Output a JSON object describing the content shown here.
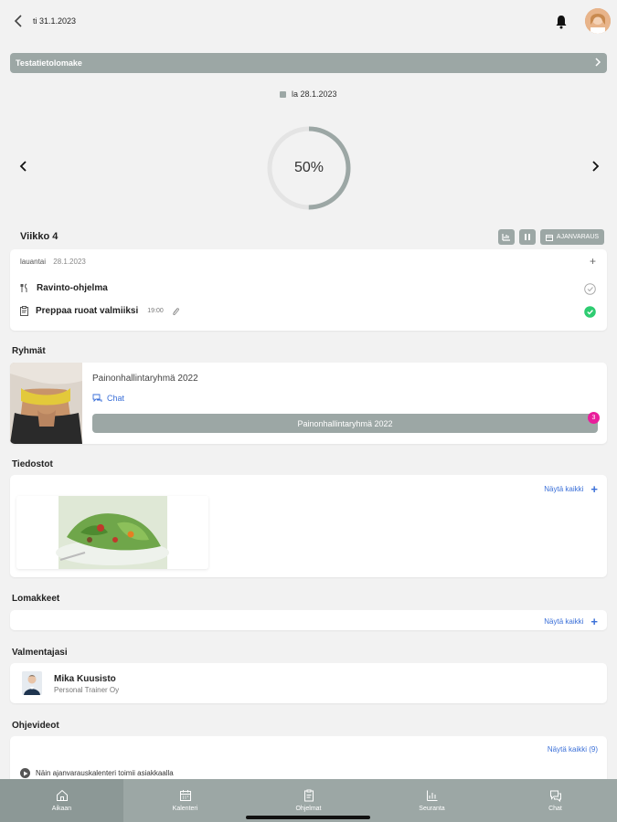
{
  "header": {
    "date": "ti 31.1.2023"
  },
  "form_bar": {
    "label": "Testatietolomake"
  },
  "day_legend": {
    "label": "la 28.1.2023"
  },
  "progress": {
    "value_text": "50%",
    "fraction": 0.5
  },
  "week": {
    "title": "Viikko 4",
    "button_calendar_label": "AJANVARAUS"
  },
  "day_card": {
    "weekday": "lauantai",
    "date": "28.1.2023",
    "tasks": [
      {
        "title": "Ravinto-ohjelma",
        "time": "",
        "done": false
      },
      {
        "title": "Preppaa ruoat valmiiksi",
        "time": "19:00",
        "done": true
      }
    ]
  },
  "groups": {
    "section_title": "Ryhmät",
    "name": "Painonhallintaryhmä 2022",
    "chat_label": "Chat",
    "button_label": "Painonhallintaryhmä 2022",
    "badge": "3"
  },
  "files": {
    "section_title": "Tiedostot",
    "show_all": "Näytä kaikki"
  },
  "forms": {
    "section_title": "Lomakkeet",
    "show_all": "Näytä kaikki"
  },
  "coach": {
    "section_title": "Valmentajasi",
    "name": "Mika Kuusisto",
    "company": "Personal Trainer Oy"
  },
  "videos": {
    "section_title": "Ohjevideot",
    "show_all": "Näytä kaikki (9)",
    "items": [
      {
        "title": "Näin ajanvarauskalenteri toimii asiakkaalla"
      }
    ]
  },
  "tabs": [
    {
      "label": "Aikaan",
      "icon": "home-icon",
      "active": true
    },
    {
      "label": "Kalenteri",
      "icon": "calendar-icon",
      "active": false
    },
    {
      "label": "Ohjelmat",
      "icon": "clipboard-icon",
      "active": false
    },
    {
      "label": "Seuranta",
      "icon": "chart-icon",
      "active": false
    },
    {
      "label": "Chat",
      "icon": "chat-icon",
      "active": false
    }
  ],
  "colors": {
    "accent": "#9ca7a5",
    "link": "#3a6fd8",
    "done": "#2ecc71",
    "badge": "#e91e9b"
  }
}
